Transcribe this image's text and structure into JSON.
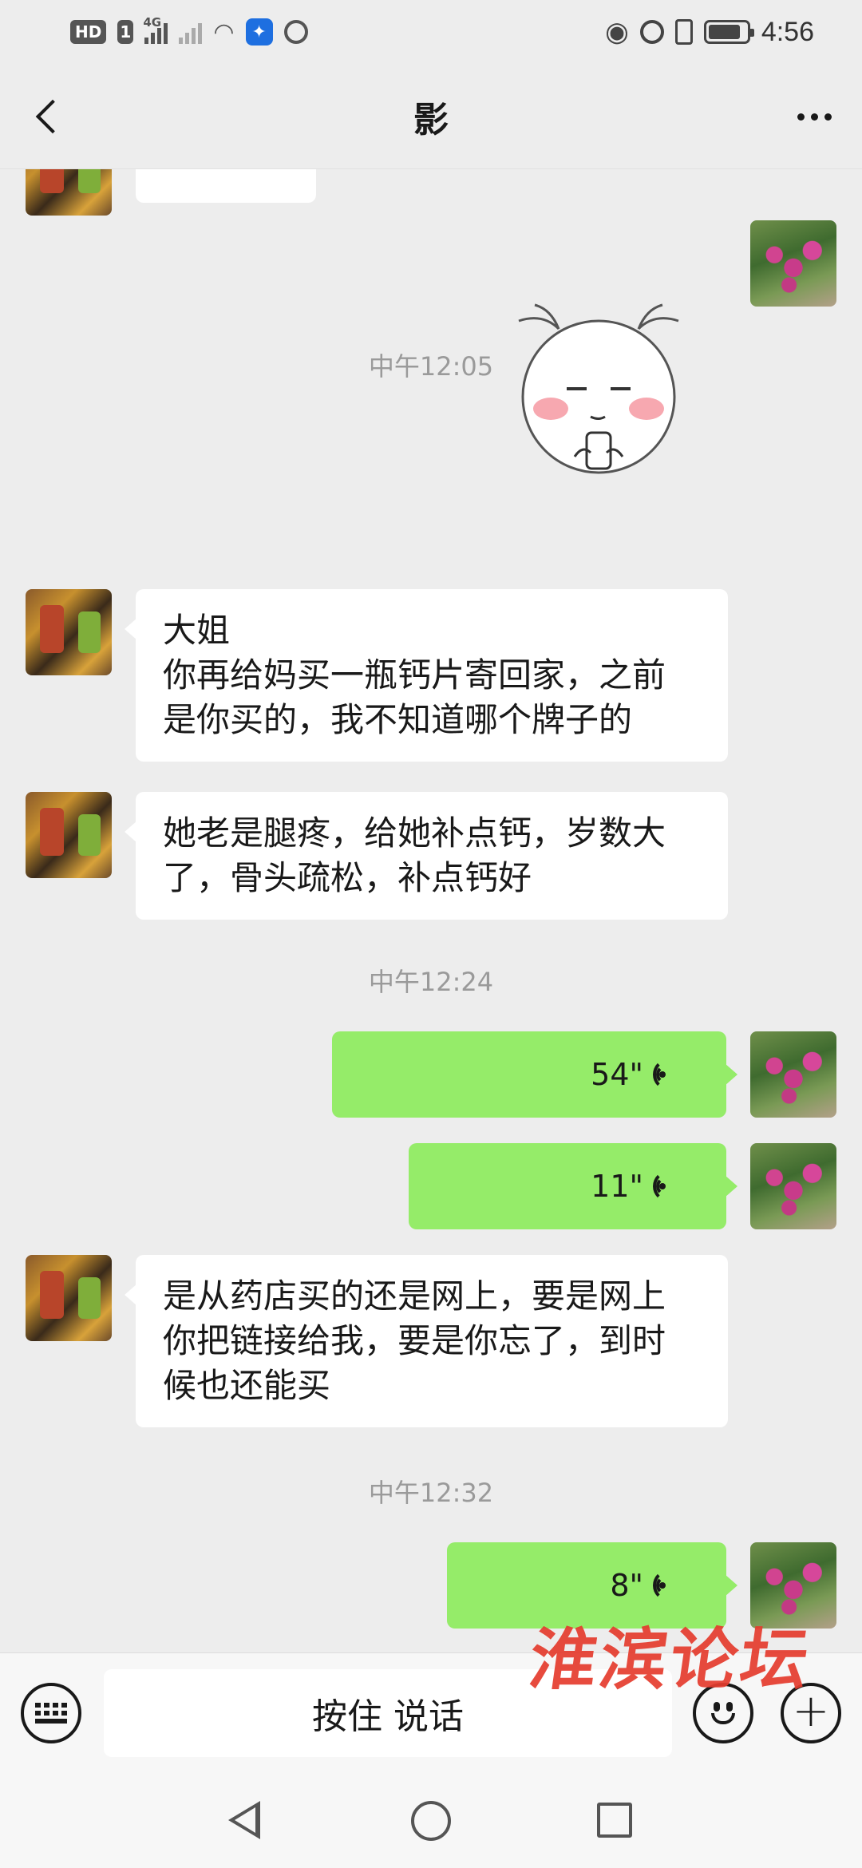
{
  "status_bar": {
    "hd": "HD",
    "sim": "1",
    "network": "4G",
    "time": "4:56"
  },
  "nav": {
    "title": "影",
    "back_icon": "back-arrow-icon",
    "more_icon": "more-dots-icon"
  },
  "messages": {
    "time_1": "中午12:05",
    "msg_1_line_1": "大姐",
    "msg_1_line_2": "你再给妈买一瓶钙片寄回家，之前",
    "msg_1_line_3": "是你买的，我不知道哪个牌子的",
    "msg_2_line_1": "她老是腿疼，给她补点钙，岁数大",
    "msg_2_line_2": "了，骨头疏松，补点钙好",
    "time_2": "中午12:24",
    "voice_1": "54\"",
    "voice_2": "11\"",
    "msg_3_line_1": "是从药店买的还是网上，要是网上",
    "msg_3_line_2": "你把链接给我，要是你忘了，到时",
    "msg_3_line_3": "候也还能买",
    "time_3": "中午12:32",
    "voice_3": "8\""
  },
  "input_bar": {
    "talk_label": "按住 说话"
  },
  "watermark": "淮滨论坛",
  "colors": {
    "background": "#ededed",
    "bubble_in": "#ffffff",
    "bubble_out": "#95ec69",
    "timestamp": "#9a9a9a",
    "watermark": "#e53c2e"
  }
}
